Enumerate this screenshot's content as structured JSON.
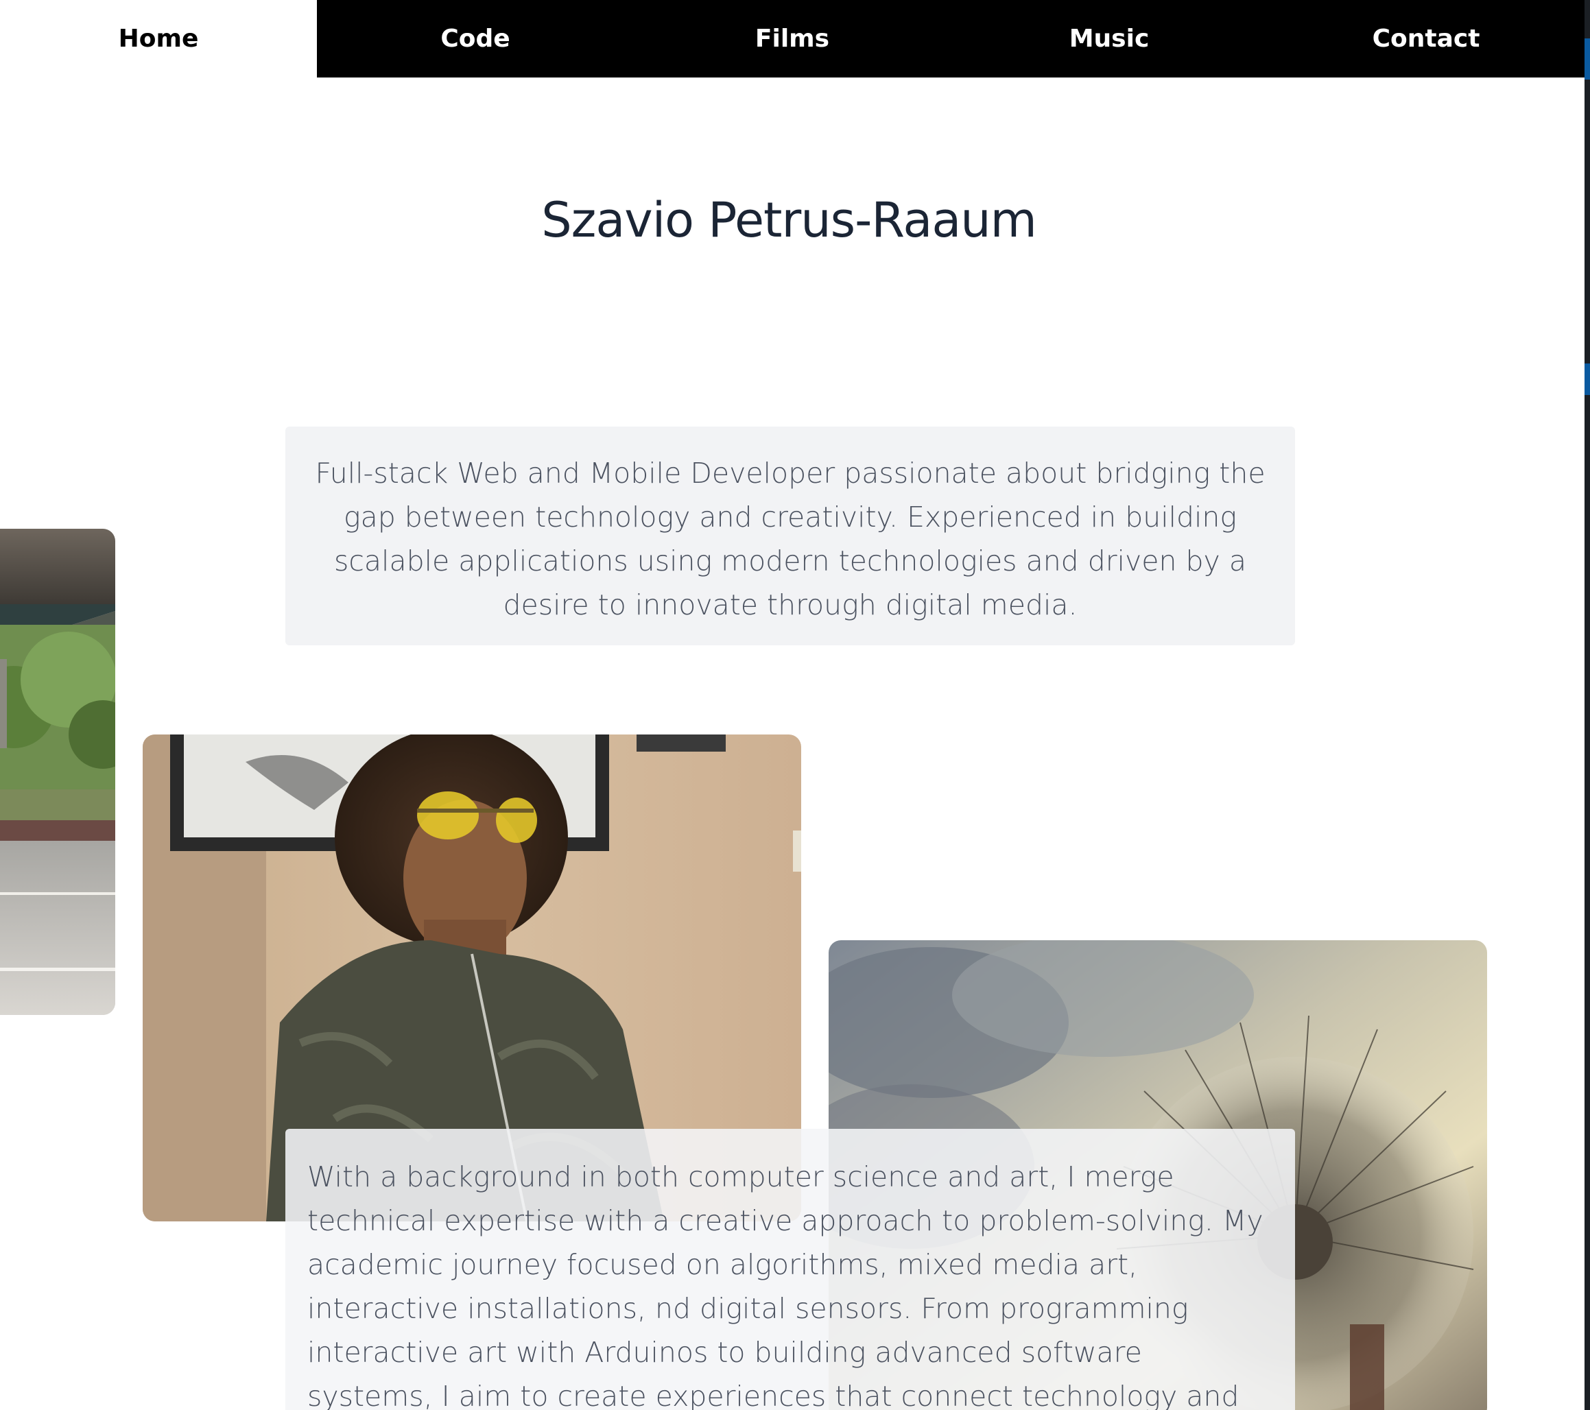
{
  "nav": {
    "items": [
      {
        "label": "Home",
        "active": true
      },
      {
        "label": "Code",
        "active": false
      },
      {
        "label": "Films",
        "active": false
      },
      {
        "label": "Music",
        "active": false
      },
      {
        "label": "Contact",
        "active": false
      }
    ]
  },
  "header": {
    "title": "Szavio Petrus-Raaum"
  },
  "intro": {
    "text": "Full-stack Web and Mobile Developer passionate about bridging the gap between technology and creativity. Experienced in building scalable applications using modern technologies and driven by a desire to innovate through digital media."
  },
  "bio": {
    "text": "With a background in both computer science and art, I merge technical expertise with a creative approach to problem-solving. My academic journey focused on algorithms, mixed media art, interactive installations, nd digital sensors. From programming interactive art with Arduinos to building advanced software systems, I aim to create experiences that connect technology and human interaction in innovative ways. Beyond"
  },
  "colors": {
    "nav_bg": "#000000",
    "nav_text": "#ffffff",
    "active_bg": "#ffffff",
    "title": "#1b2535",
    "card_bg": "#f2f3f5",
    "body_text": "#4b5260"
  }
}
